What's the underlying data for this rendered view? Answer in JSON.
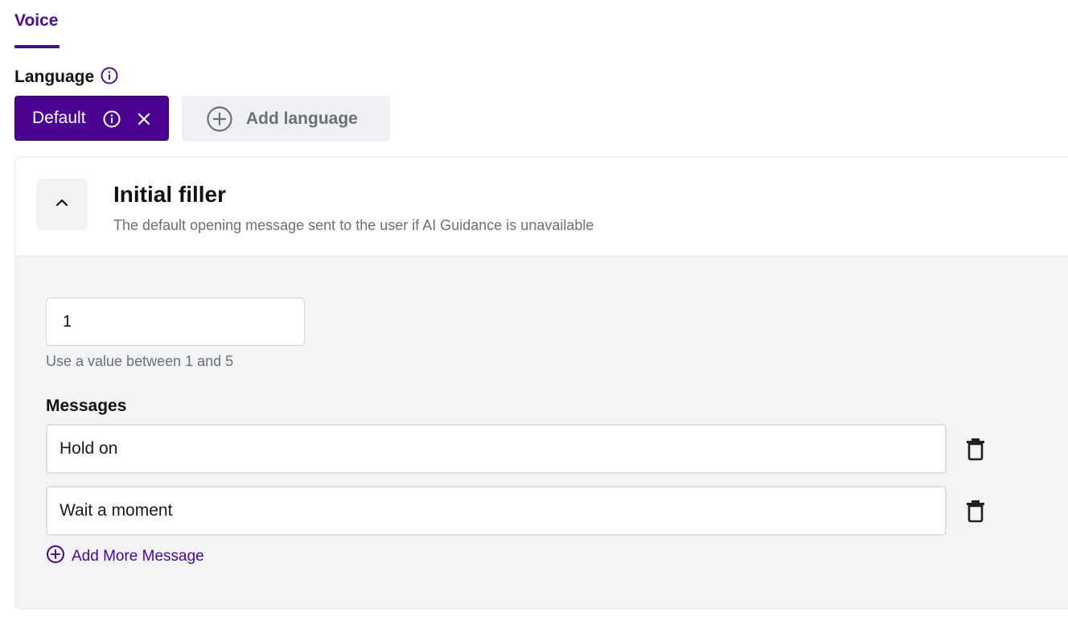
{
  "tabs": {
    "active": "Voice"
  },
  "language": {
    "label": "Language",
    "chip": {
      "label": "Default"
    },
    "add_button": "Add language"
  },
  "card": {
    "title": "Initial filler",
    "description": "The default opening message sent to the user if AI Guidance is unavailable",
    "count": {
      "value": "1",
      "hint": "Use a value between 1 and 5"
    },
    "messages_label": "Messages",
    "messages": [
      "Hold on",
      "Wait a moment"
    ],
    "add_more": "Add More Message"
  },
  "colors": {
    "accent": "#4b0491",
    "muted_text": "#6b6f76",
    "panel_bg": "#f3f4f6"
  },
  "icons": [
    "info-icon",
    "close-icon",
    "plus-circle-icon",
    "chevron-up-icon",
    "trash-icon"
  ]
}
